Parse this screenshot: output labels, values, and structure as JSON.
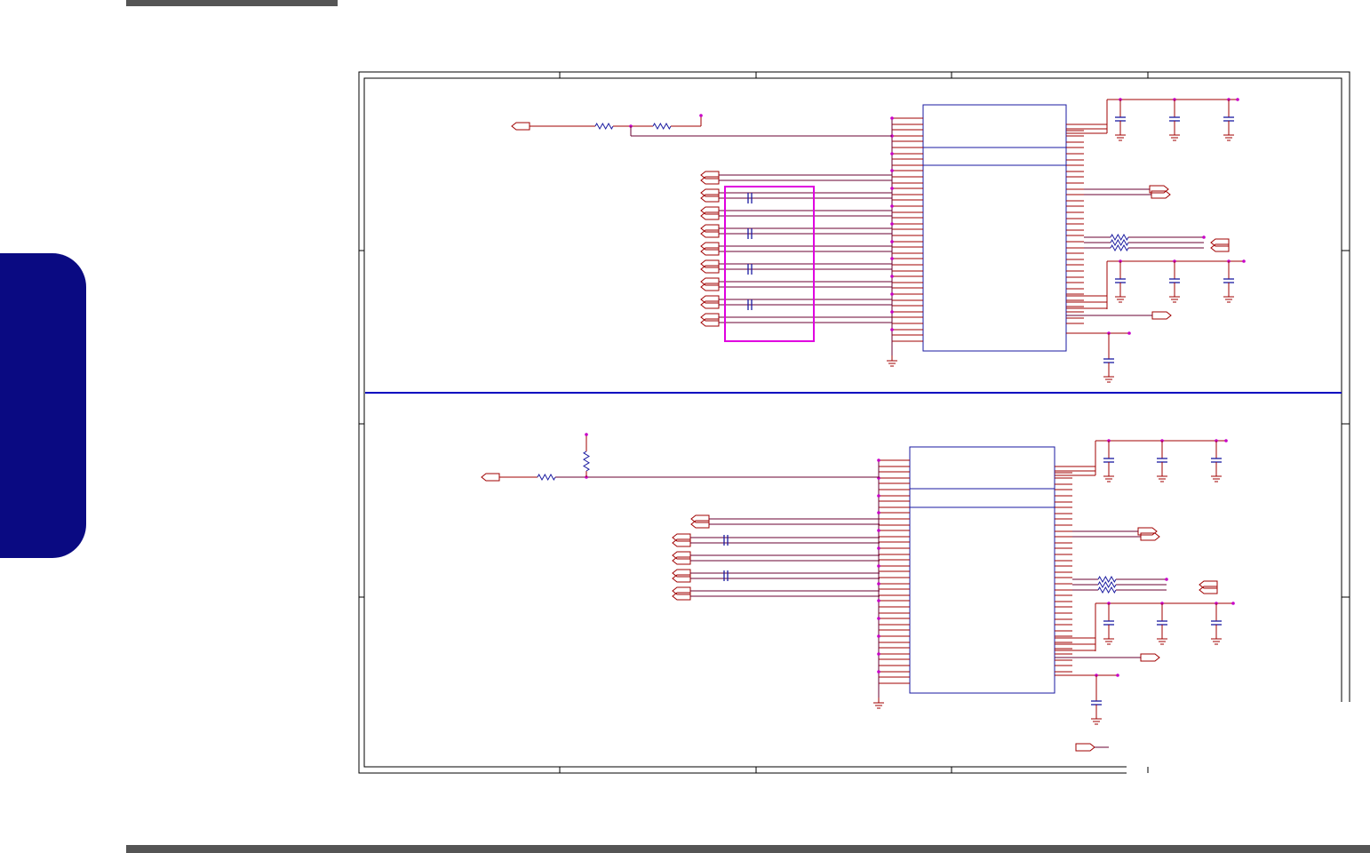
{
  "colors": {
    "bar": "#555555",
    "tab": "#0a0a82",
    "frame": "#000000",
    "wire": "#a00000",
    "net": "#6a0030",
    "component": "#1a1aa0",
    "junction": "#c800c8",
    "highlight": "#e000e0",
    "divider": "#0000c0"
  },
  "decor": {
    "top_bar": "gray-header-bar",
    "bottom_bar": "gray-footer-bar",
    "side_tab": "navy-chapter-tab"
  },
  "schematic": {
    "kind": "circuit-schematic",
    "sheets": [
      {
        "id": "upper",
        "ic": "ic-block",
        "input_caps": 4,
        "output_resistors": 3,
        "supply_caps": 6
      },
      {
        "id": "lower",
        "ic": "ic-block",
        "input_caps": 2,
        "output_resistors": 3,
        "supply_caps": 6
      }
    ]
  }
}
